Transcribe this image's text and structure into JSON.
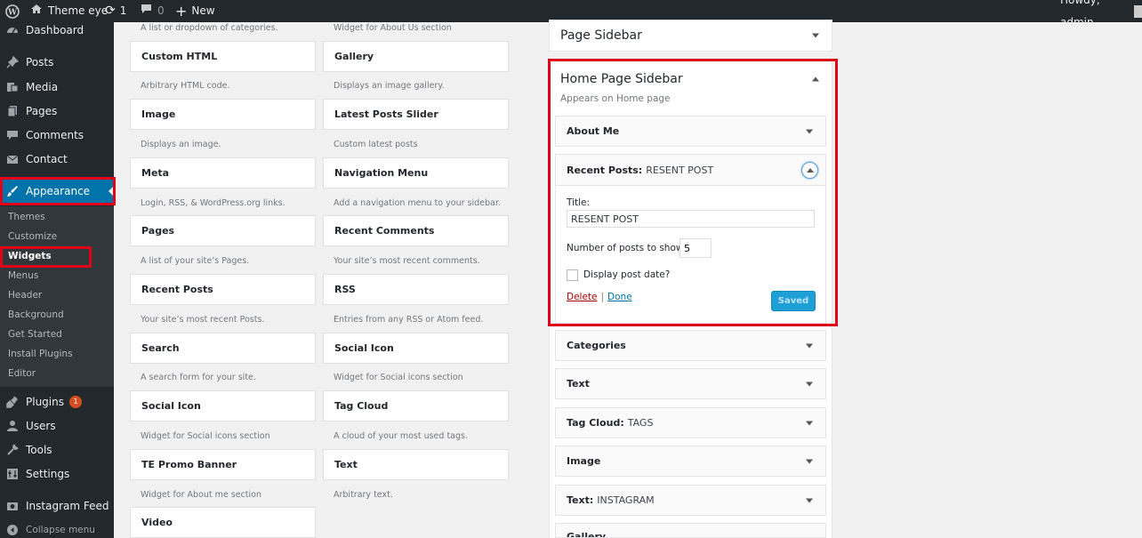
{
  "adminbar": {
    "site_name": "Theme eye",
    "updates_count": "1",
    "comments_count": "0",
    "new_label": "New",
    "howdy": "Howdy, admin"
  },
  "sidebar": {
    "items": [
      {
        "label": "Dashboard",
        "icon": "dashboard-icon"
      },
      {
        "label": "Posts",
        "icon": "pin-icon"
      },
      {
        "label": "Media",
        "icon": "media-icon"
      },
      {
        "label": "Pages",
        "icon": "pages-icon"
      },
      {
        "label": "Comments",
        "icon": "comment-icon"
      },
      {
        "label": "Contact",
        "icon": "mail-icon"
      },
      {
        "label": "Appearance",
        "icon": "brush-icon"
      },
      {
        "label": "Plugins",
        "icon": "plug-icon",
        "badge": "1"
      },
      {
        "label": "Users",
        "icon": "user-icon"
      },
      {
        "label": "Tools",
        "icon": "wrench-icon"
      },
      {
        "label": "Settings",
        "icon": "settings-icon"
      },
      {
        "label": "Instagram Feed",
        "icon": "camera-icon"
      },
      {
        "label": "Collapse menu",
        "icon": "collapse-icon"
      }
    ],
    "submenu": [
      "Themes",
      "Customize",
      "Widgets",
      "Menus",
      "Header",
      "Background",
      "Get Started",
      "Install Plugins",
      "Editor"
    ]
  },
  "widgets": {
    "top_desc_left": "A list or dropdown of categories.",
    "top_desc_right": "Widget for About Us section",
    "left": [
      {
        "name": "Custom HTML",
        "desc": "Arbitrary HTML code."
      },
      {
        "name": "Image",
        "desc": "Displays an image."
      },
      {
        "name": "Meta",
        "desc": "Login, RSS, & WordPress.org links."
      },
      {
        "name": "Pages",
        "desc": "A list of your site’s Pages."
      },
      {
        "name": "Recent Posts",
        "desc": "Your site’s most recent Posts."
      },
      {
        "name": "Search",
        "desc": "A search form for your site."
      },
      {
        "name": "Social Icon",
        "desc": "Widget for Social icons section"
      },
      {
        "name": "TE Promo Banner",
        "desc": "Widget for About me section"
      },
      {
        "name": "Video",
        "desc": ""
      }
    ],
    "right": [
      {
        "name": "Gallery",
        "desc": "Displays an image gallery."
      },
      {
        "name": "Latest Posts Slider",
        "desc": "Custom latest posts"
      },
      {
        "name": "Navigation Menu",
        "desc": "Add a navigation menu to your sidebar."
      },
      {
        "name": "Recent Comments",
        "desc": "Your site’s most recent comments."
      },
      {
        "name": "RSS",
        "desc": "Entries from any RSS or Atom feed."
      },
      {
        "name": "Social Icon",
        "desc": "Widget for Social icons section"
      },
      {
        "name": "Tag Cloud",
        "desc": "A cloud of your most used tags."
      },
      {
        "name": "Text",
        "desc": "Arbitrary text."
      }
    ]
  },
  "areas": {
    "page_sidebar": "Page Sidebar",
    "home_sidebar": "Home Page Sidebar",
    "home_desc": "Appears on Home page",
    "about_me": "About Me",
    "recent_posts": {
      "name": "Recent Posts:",
      "sub": "RESENT POST",
      "title_label": "Title:",
      "title_value": "RESENT POST",
      "number_label": "Number of posts to show:",
      "number_value": "5",
      "date_label": "Display post date?",
      "delete": "Delete",
      "separator": "|",
      "done": "Done",
      "saved": "Saved"
    },
    "after": [
      {
        "name": "Categories",
        "sub": ""
      },
      {
        "name": "Text",
        "sub": ""
      },
      {
        "name": "Tag Cloud:",
        "sub": "TAGS"
      },
      {
        "name": "Image",
        "sub": ""
      },
      {
        "name": "Text:",
        "sub": "INSTAGRAM"
      },
      {
        "name": "Gallery",
        "sub": ""
      }
    ]
  },
  "colors": {
    "accent": "#0073aa",
    "highlight": "#e0001a",
    "saved_button": "#1e9fd6"
  }
}
